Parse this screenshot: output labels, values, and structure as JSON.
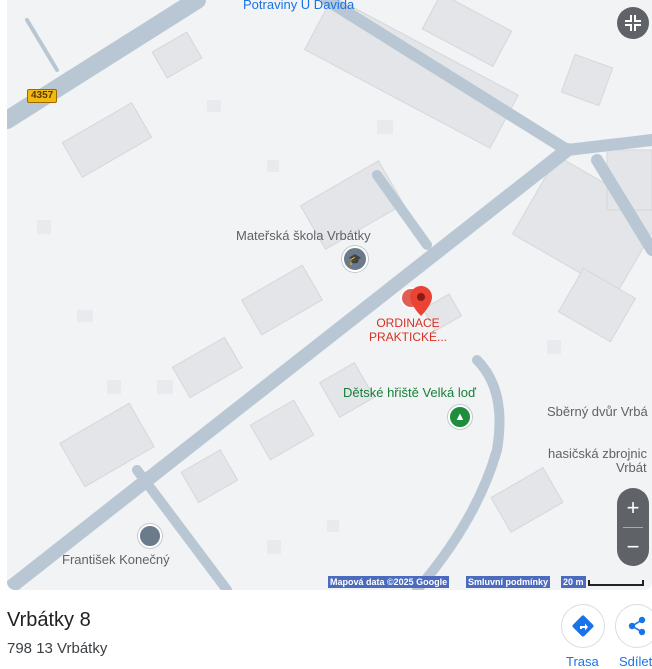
{
  "map": {
    "road_number": "4357",
    "labels": {
      "potraviny": "Potraviny U Davida",
      "materska_skola": "Mateřská škola Vrbátky",
      "ordinace_line1": "ORDINACE",
      "ordinace_line2": "PRAKTICKÉ...",
      "detske_hriste": "Dětské hřiště Velká loď",
      "sberny_dvur": "Sběrný dvůr Vrbá",
      "hasicska_line1": "hasičská zbrojnic",
      "hasicska_line2": "Vrbát",
      "frantisek": "František Konečný"
    },
    "attribution": {
      "map_data": "Mapová data ©2025 Google",
      "terms": "Smluvní podmínky",
      "scale": "20 m"
    },
    "controls": {
      "collapse_icon": "collapse-icon",
      "zoom_in": "+",
      "zoom_out": "−"
    }
  },
  "place": {
    "title": "Vrbátky 8",
    "address": "798 13 Vrbátky"
  },
  "actions": [
    {
      "label": "Trasa",
      "icon": "directions-icon"
    },
    {
      "label": "Sdílet",
      "icon": "share-icon"
    }
  ]
}
